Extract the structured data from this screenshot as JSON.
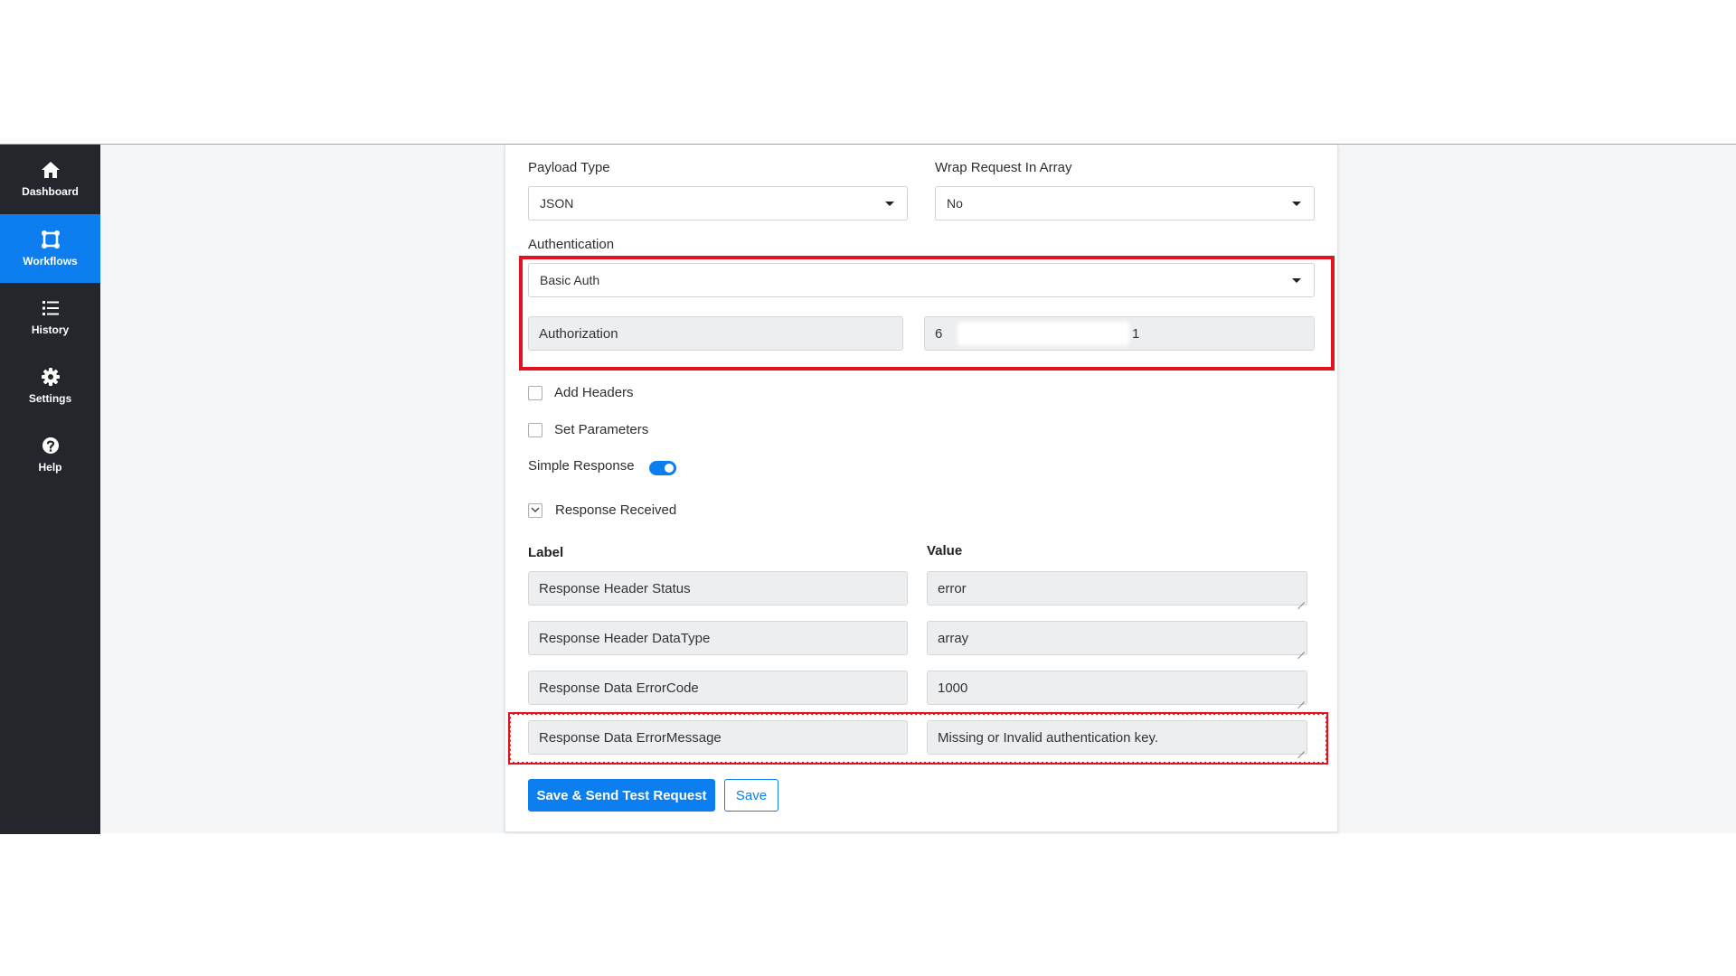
{
  "sidebar": {
    "items": [
      {
        "label": "Dashboard",
        "icon": "home-icon",
        "active": false
      },
      {
        "label": "Workflows",
        "icon": "workflow-icon",
        "active": true
      },
      {
        "label": "History",
        "icon": "list-icon",
        "active": false
      },
      {
        "label": "Settings",
        "icon": "gear-icon",
        "active": false
      },
      {
        "label": "Help",
        "icon": "help-icon",
        "active": false
      }
    ]
  },
  "form": {
    "payload_type": {
      "label": "Payload Type",
      "value": "JSON"
    },
    "wrap_request": {
      "label": "Wrap Request In Array",
      "value": "No"
    },
    "authentication": {
      "label": "Authentication",
      "value": "Basic Auth",
      "header_name": "Authorization",
      "header_value_start": "6",
      "header_value_end": "1"
    },
    "add_headers": {
      "label": "Add Headers",
      "checked": false
    },
    "set_parameters": {
      "label": "Set Parameters",
      "checked": false
    },
    "simple_response": {
      "label": "Simple Response",
      "on": true
    },
    "response_received": {
      "label": "Response Received",
      "expanded": true
    }
  },
  "response_table": {
    "label_header": "Label",
    "value_header": "Value",
    "rows": [
      {
        "label": "Response Header Status",
        "value": "error"
      },
      {
        "label": "Response Header DataType",
        "value": "array"
      },
      {
        "label": "Response Data ErrorCode",
        "value": "1000"
      },
      {
        "label": "Response Data ErrorMessage",
        "value": "Missing or Invalid authentication key."
      }
    ]
  },
  "buttons": {
    "save_send": "Save & Send Test Request",
    "save": "Save"
  },
  "colors": {
    "accent": "#0d7ef0",
    "sidebar_bg": "#23272b",
    "highlight": "#e0131f"
  }
}
